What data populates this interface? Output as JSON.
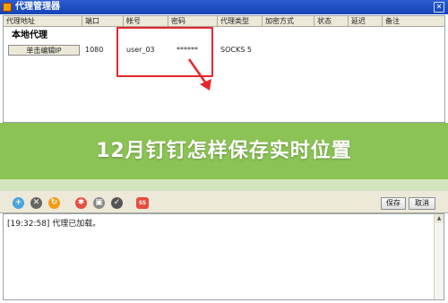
{
  "window": {
    "title": "代理管理器"
  },
  "table": {
    "columns": [
      "代理地址",
      "端口",
      "帐号",
      "密码",
      "代理类型",
      "加密方式",
      "状态",
      "延迟",
      "备注"
    ],
    "group_label": "本地代理",
    "row": {
      "edit_button": "单击编辑IP",
      "port": "1080",
      "account": "user_03",
      "password": "******",
      "type": "SOCKS 5"
    }
  },
  "banner": {
    "text": "12月钉钉怎样保存实时位置"
  },
  "toolbar": {
    "save_label": "保存",
    "cancel_label": "取消"
  },
  "log": {
    "line1": "[19:32:58]  代理已加载。"
  },
  "colors": {
    "annotation": "#e5262d",
    "banner": "#82be46",
    "titlebar": "#1645b6"
  },
  "icons": [
    "app-icon",
    "add-icon",
    "delete-icon",
    "refresh-icon",
    "settings-icon",
    "lock-icon",
    "check-icon",
    "ss-icon"
  ]
}
